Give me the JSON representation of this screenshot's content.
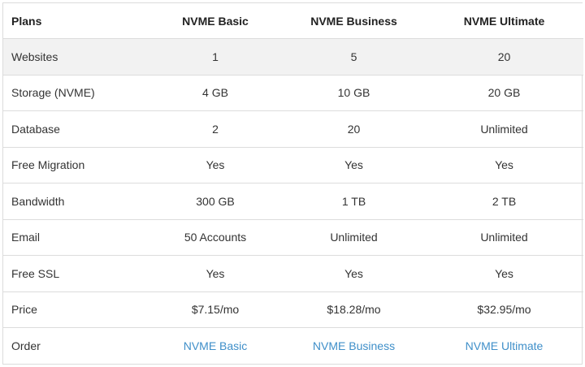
{
  "table": {
    "headers": [
      "Plans",
      "NVME Basic",
      "NVME Business",
      "NVME Ultimate"
    ],
    "rows": [
      {
        "label": "Websites",
        "values": [
          "1",
          "5",
          "20"
        ]
      },
      {
        "label": "Storage (NVME)",
        "values": [
          "4 GB",
          "10 GB",
          "20 GB"
        ]
      },
      {
        "label": "Database",
        "values": [
          "2",
          "20",
          "Unlimited"
        ]
      },
      {
        "label": "Free Migration",
        "values": [
          "Yes",
          "Yes",
          "Yes"
        ]
      },
      {
        "label": "Bandwidth",
        "values": [
          "300 GB",
          "1 TB",
          "2 TB"
        ]
      },
      {
        "label": "Email",
        "values": [
          "50 Accounts",
          "Unlimited",
          "Unlimited"
        ]
      },
      {
        "label": "Free SSL",
        "values": [
          "Yes",
          "Yes",
          "Yes"
        ]
      },
      {
        "label": "Price",
        "values": [
          "$7.15/mo",
          "$18.28/mo",
          "$32.95/mo"
        ]
      },
      {
        "label": "Order",
        "values": [
          "NVME Basic",
          "NVME Business",
          "NVME Ultimate"
        ]
      }
    ]
  },
  "colors": {
    "link": "#3f8fc9",
    "highlight_row": "#f2f2f2",
    "border": "#dcdcdc"
  }
}
